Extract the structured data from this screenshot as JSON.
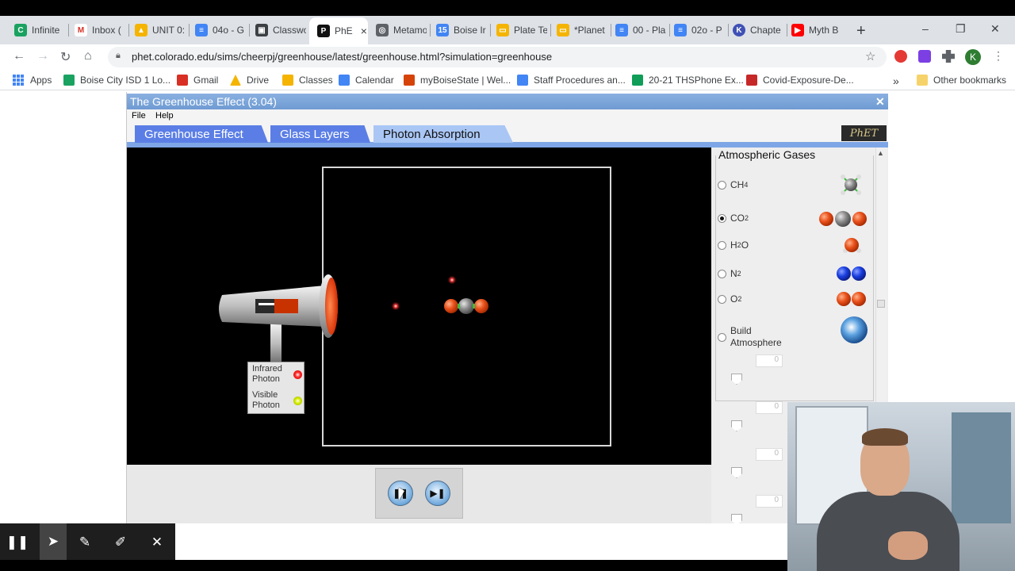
{
  "browser": {
    "tabs": [
      {
        "label": "Infinite",
        "icon": "infinite-campus-icon",
        "color": "#1aa260"
      },
      {
        "label": "Inbox (",
        "icon": "gmail-icon",
        "color": "#d93025"
      },
      {
        "label": "UNIT 0:",
        "icon": "google-drive-icon",
        "color": "#f4b400"
      },
      {
        "label": "04o - G",
        "icon": "google-docs-icon",
        "color": "#4285f4"
      },
      {
        "label": "Classwo",
        "icon": "classroom-icon",
        "color": "#3c4043"
      },
      {
        "label": "PhE",
        "icon": "phet-icon",
        "color": "#111111",
        "active": true
      },
      {
        "label": "Metamo",
        "icon": "globe-icon",
        "color": "#5f6368"
      },
      {
        "label": "Boise Ir",
        "icon": "calendar-icon",
        "color": "#4285f4"
      },
      {
        "label": "Plate Te",
        "icon": "slides-icon",
        "color": "#f4b400"
      },
      {
        "label": "*Planet",
        "icon": "slides-icon",
        "color": "#f4b400"
      },
      {
        "label": "00 - Pla",
        "icon": "google-docs-icon",
        "color": "#4285f4"
      },
      {
        "label": "02o - P",
        "icon": "google-docs-icon",
        "color": "#4285f4"
      },
      {
        "label": "Chapte",
        "icon": "k-icon",
        "color": "#3f51b5"
      },
      {
        "label": "Myth B",
        "icon": "youtube-icon",
        "color": "#ff0000"
      }
    ],
    "active_tab_close": "×",
    "new_tab": "+",
    "window_controls": {
      "minimize": "–",
      "restore": "❐",
      "close": "✕"
    },
    "url": "phet.colorado.edu/sims/cheerpj/greenhouse/latest/greenhouse.html?simulation=greenhouse",
    "avatar_letter": "K",
    "bookmarks": [
      {
        "label": "Apps",
        "icon": "apps-grid-icon"
      },
      {
        "label": "Boise City ISD 1 Lo...",
        "icon": "infinite-campus-icon",
        "color": "#1aa260"
      },
      {
        "label": "Gmail",
        "icon": "gmail-icon",
        "color": "#d93025"
      },
      {
        "label": "Drive",
        "icon": "google-drive-icon",
        "color": "#f4b400"
      },
      {
        "label": "Classes",
        "icon": "classroom-icon",
        "color": "#f4b400"
      },
      {
        "label": "Calendar",
        "icon": "calendar-icon",
        "color": "#4285f4"
      },
      {
        "label": "myBoiseState | Wel...",
        "icon": "boise-state-icon",
        "color": "#d64309"
      },
      {
        "label": "Staff Procedures an...",
        "icon": "google-docs-icon",
        "color": "#4285f4"
      },
      {
        "label": "20-21 THSPhone Ex...",
        "icon": "sheets-icon",
        "color": "#0f9d58"
      },
      {
        "label": "Covid-Exposure-De...",
        "icon": "pdf-icon",
        "color": "#c62828"
      }
    ],
    "bookmarks_overflow": "»",
    "other_bookmarks": "Other bookmarks"
  },
  "app": {
    "title": "The Greenhouse Effect (3.04)",
    "close": "✕",
    "menu": [
      "File",
      "Help"
    ],
    "tabs": [
      "Greenhouse Effect",
      "Glass Layers",
      "Photon Absorption"
    ],
    "active_tab": "Photon Absorption",
    "logo": "PhET",
    "emitter_legend": {
      "infrared": "Infrared\nPhoton",
      "visible": "Visible\nPhoton"
    },
    "emitter_selected": "Infrared Photon",
    "panel": {
      "title": "Atmospheric Gases",
      "gases": [
        {
          "label": "CH",
          "sub": "4",
          "selected": false
        },
        {
          "label": "CO",
          "sub": "2",
          "selected": true
        },
        {
          "label": "H",
          "sub": "2",
          "suffix": "O",
          "selected": false
        },
        {
          "label": "N",
          "sub": "2",
          "selected": false
        },
        {
          "label": "O",
          "sub": "2",
          "selected": false
        },
        {
          "label": "Build Atmosphere",
          "selected": false
        }
      ],
      "slider_values": [
        "0",
        "0",
        "0",
        "0"
      ]
    },
    "controls": {
      "play_pause": "❚❚",
      "step": "▶❚"
    },
    "colors": {
      "oxygen": "#e8501a",
      "carbon": "#8a8a8a",
      "nitrogen": "#1a3fe0",
      "infrared": "#ff2a2a",
      "visible": "#d6f000",
      "tab_blue": "#5b7ee6"
    }
  },
  "recorder": {
    "tools": [
      "pause-icon",
      "cursor-icon",
      "pen-icon",
      "highlighter-icon",
      "close-icon"
    ]
  }
}
